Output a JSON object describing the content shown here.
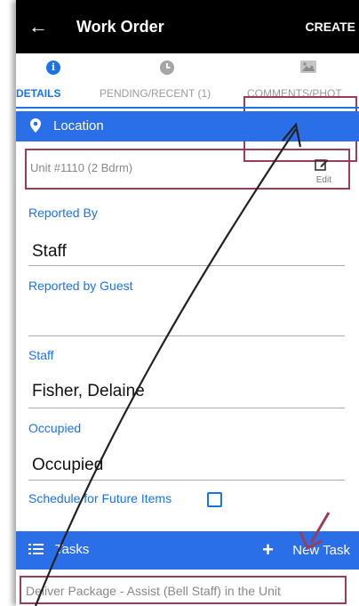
{
  "header": {
    "back_icon": "back-arrow-icon",
    "title": "Work Order",
    "create_label": "CREATE"
  },
  "tabs": [
    {
      "label": "DETAILS",
      "icon": "info-icon",
      "active": true
    },
    {
      "label": "PENDING/RECENT (1)",
      "icon": "clock-icon",
      "active": false
    },
    {
      "label": "COMMENTS/PHOT",
      "icon": "image-icon",
      "active": false
    }
  ],
  "location": {
    "icon": "map-pin-icon",
    "label": "Location",
    "unit_value": "Unit #1110 (2 Bdrm)",
    "edit_label": "Edit"
  },
  "fields": {
    "reported_by_label": "Reported By",
    "reported_by_value": "Staff",
    "reported_by_guest_label": "Reported by Guest",
    "reported_by_guest_value": "",
    "staff_label": "Staff",
    "staff_value": "Fisher, Delaine",
    "occupied_label": "Occupied",
    "occupied_value": "Occupied"
  },
  "schedule": {
    "label": "Schedule for Future Items",
    "checked": false
  },
  "tasks": {
    "icon": "list-icon",
    "label": "Tasks",
    "new_task_label": "New Task",
    "items": [
      "Deliver Package - Assist (Bell Staff) in the Unit"
    ]
  },
  "colors": {
    "accent": "#2a6ee8",
    "link": "#1a73e8",
    "header_bg": "#000000",
    "highlight_box": "#9a3d57"
  }
}
